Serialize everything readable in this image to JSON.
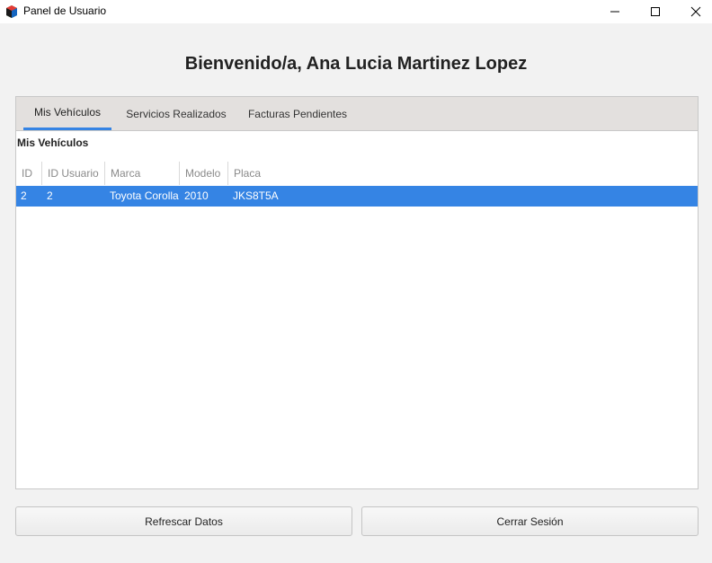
{
  "window": {
    "title": "Panel de Usuario"
  },
  "welcome": "Bienvenido/a, Ana Lucia Martinez Lopez",
  "tabs": [
    {
      "label": "Mis Vehículos",
      "active": true
    },
    {
      "label": "Servicios Realizados",
      "active": false
    },
    {
      "label": "Facturas Pendientes",
      "active": false
    }
  ],
  "section_label": "Mis Vehículos",
  "table": {
    "headers": [
      "ID",
      "ID Usuario",
      "Marca",
      "Modelo",
      "Placa"
    ],
    "rows": [
      [
        "2",
        "2",
        "Toyota Corolla",
        "2010",
        "JKS8T5A"
      ]
    ]
  },
  "buttons": {
    "refresh": "Refrescar Datos",
    "logout": "Cerrar Sesión"
  },
  "colors": {
    "accent": "#3584e4",
    "tab_bar": "#e3e0de",
    "background": "#f2f2f2"
  },
  "icons": {
    "app": "app-icon",
    "minimize": "minimize-icon",
    "maximize": "maximize-icon",
    "close": "close-icon"
  }
}
